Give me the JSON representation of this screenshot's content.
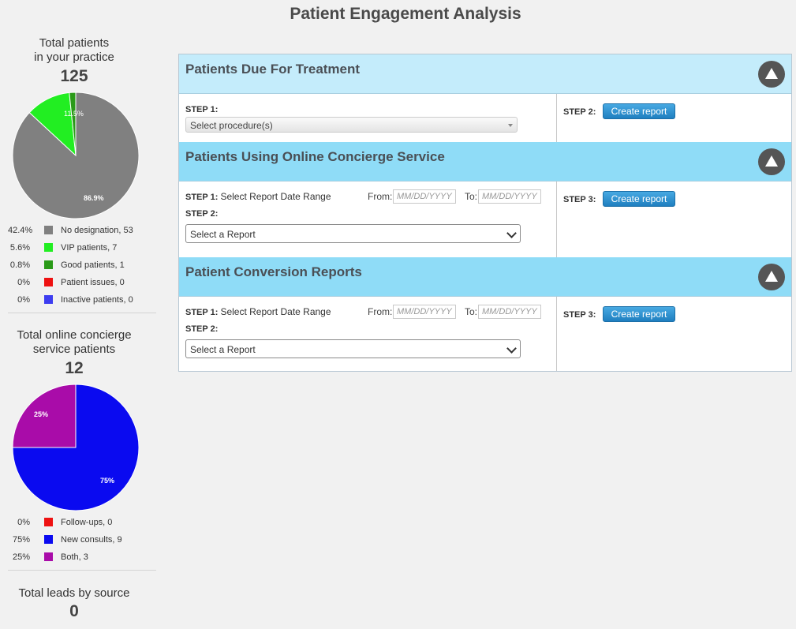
{
  "page": {
    "title": "Patient Engagement Analysis"
  },
  "stats": [
    {
      "title_line1": "Total patients",
      "title_line2": "in your practice",
      "total": "125",
      "slice_labels": [
        "11.5%",
        "86.9%"
      ],
      "legend": [
        {
          "pct": "42.4%",
          "label": "No designation, 53",
          "color": "#808080"
        },
        {
          "pct": "5.6%",
          "label": "VIP patients, 7",
          "color": "#22ee22"
        },
        {
          "pct": "0.8%",
          "label": "Good patients, 1",
          "color": "#2a9a18"
        },
        {
          "pct": "0%",
          "label": "Patient issues, 0",
          "color": "#ee1111"
        },
        {
          "pct": "0%",
          "label": "Inactive patients, 0",
          "color": "#3d3df0"
        }
      ]
    },
    {
      "title_line1": "Total online concierge",
      "title_line2": "service patients",
      "total": "12",
      "slice_labels": [
        "25%",
        "75%"
      ],
      "legend": [
        {
          "pct": "0%",
          "label": "Follow-ups, 0",
          "color": "#ee1111"
        },
        {
          "pct": "75%",
          "label": "New consults, 9",
          "color": "#0a0af0"
        },
        {
          "pct": "25%",
          "label": "Both, 3",
          "color": "#a90ca9"
        }
      ]
    },
    {
      "title_line1": "Total leads by source",
      "total": "0"
    }
  ],
  "chart_data": [
    {
      "type": "pie",
      "categories": [
        "No designation",
        "VIP patients",
        "Good patients",
        "Patient issues",
        "Inactive patients"
      ],
      "values": [
        53,
        7,
        1,
        0,
        0
      ],
      "slice_labels": [
        "86.9%",
        "11.5%",
        "",
        "",
        ""
      ],
      "colors": [
        "#808080",
        "#22ee22",
        "#2a9a18",
        "#ee1111",
        "#3d3df0"
      ]
    },
    {
      "type": "pie",
      "categories": [
        "Follow-ups",
        "New consults",
        "Both"
      ],
      "values": [
        0,
        9,
        3
      ],
      "slice_labels": [
        "",
        "75%",
        "25%"
      ],
      "colors": [
        "#ee1111",
        "#0a0af0",
        "#a90ca9"
      ]
    }
  ],
  "sections": [
    {
      "title": "Patients Due For Treatment",
      "step1_label": "STEP 1:",
      "procedure_select": "Select procedure(s)",
      "step_final_label": "STEP 2:",
      "button": "Create report"
    },
    {
      "title": "Patients Using Online Concierge Service",
      "step1_label": "STEP 1:",
      "step1_text": "Select Report Date Range",
      "from_label": "From:",
      "to_label": "To:",
      "date_placeholder": "MM/DD/YYYY",
      "step2_label": "STEP 2:",
      "report_select": "Select a Report",
      "step_final_label": "STEP 3:",
      "button": "Create report"
    },
    {
      "title": "Patient Conversion Reports",
      "step1_label": "STEP 1:",
      "step1_text": "Select Report Date Range",
      "from_label": "From:",
      "to_label": "To:",
      "date_placeholder": "MM/DD/YYYY",
      "step2_label": "STEP 2:",
      "report_select": "Select a Report",
      "step_final_label": "STEP 3:",
      "button": "Create report"
    }
  ]
}
